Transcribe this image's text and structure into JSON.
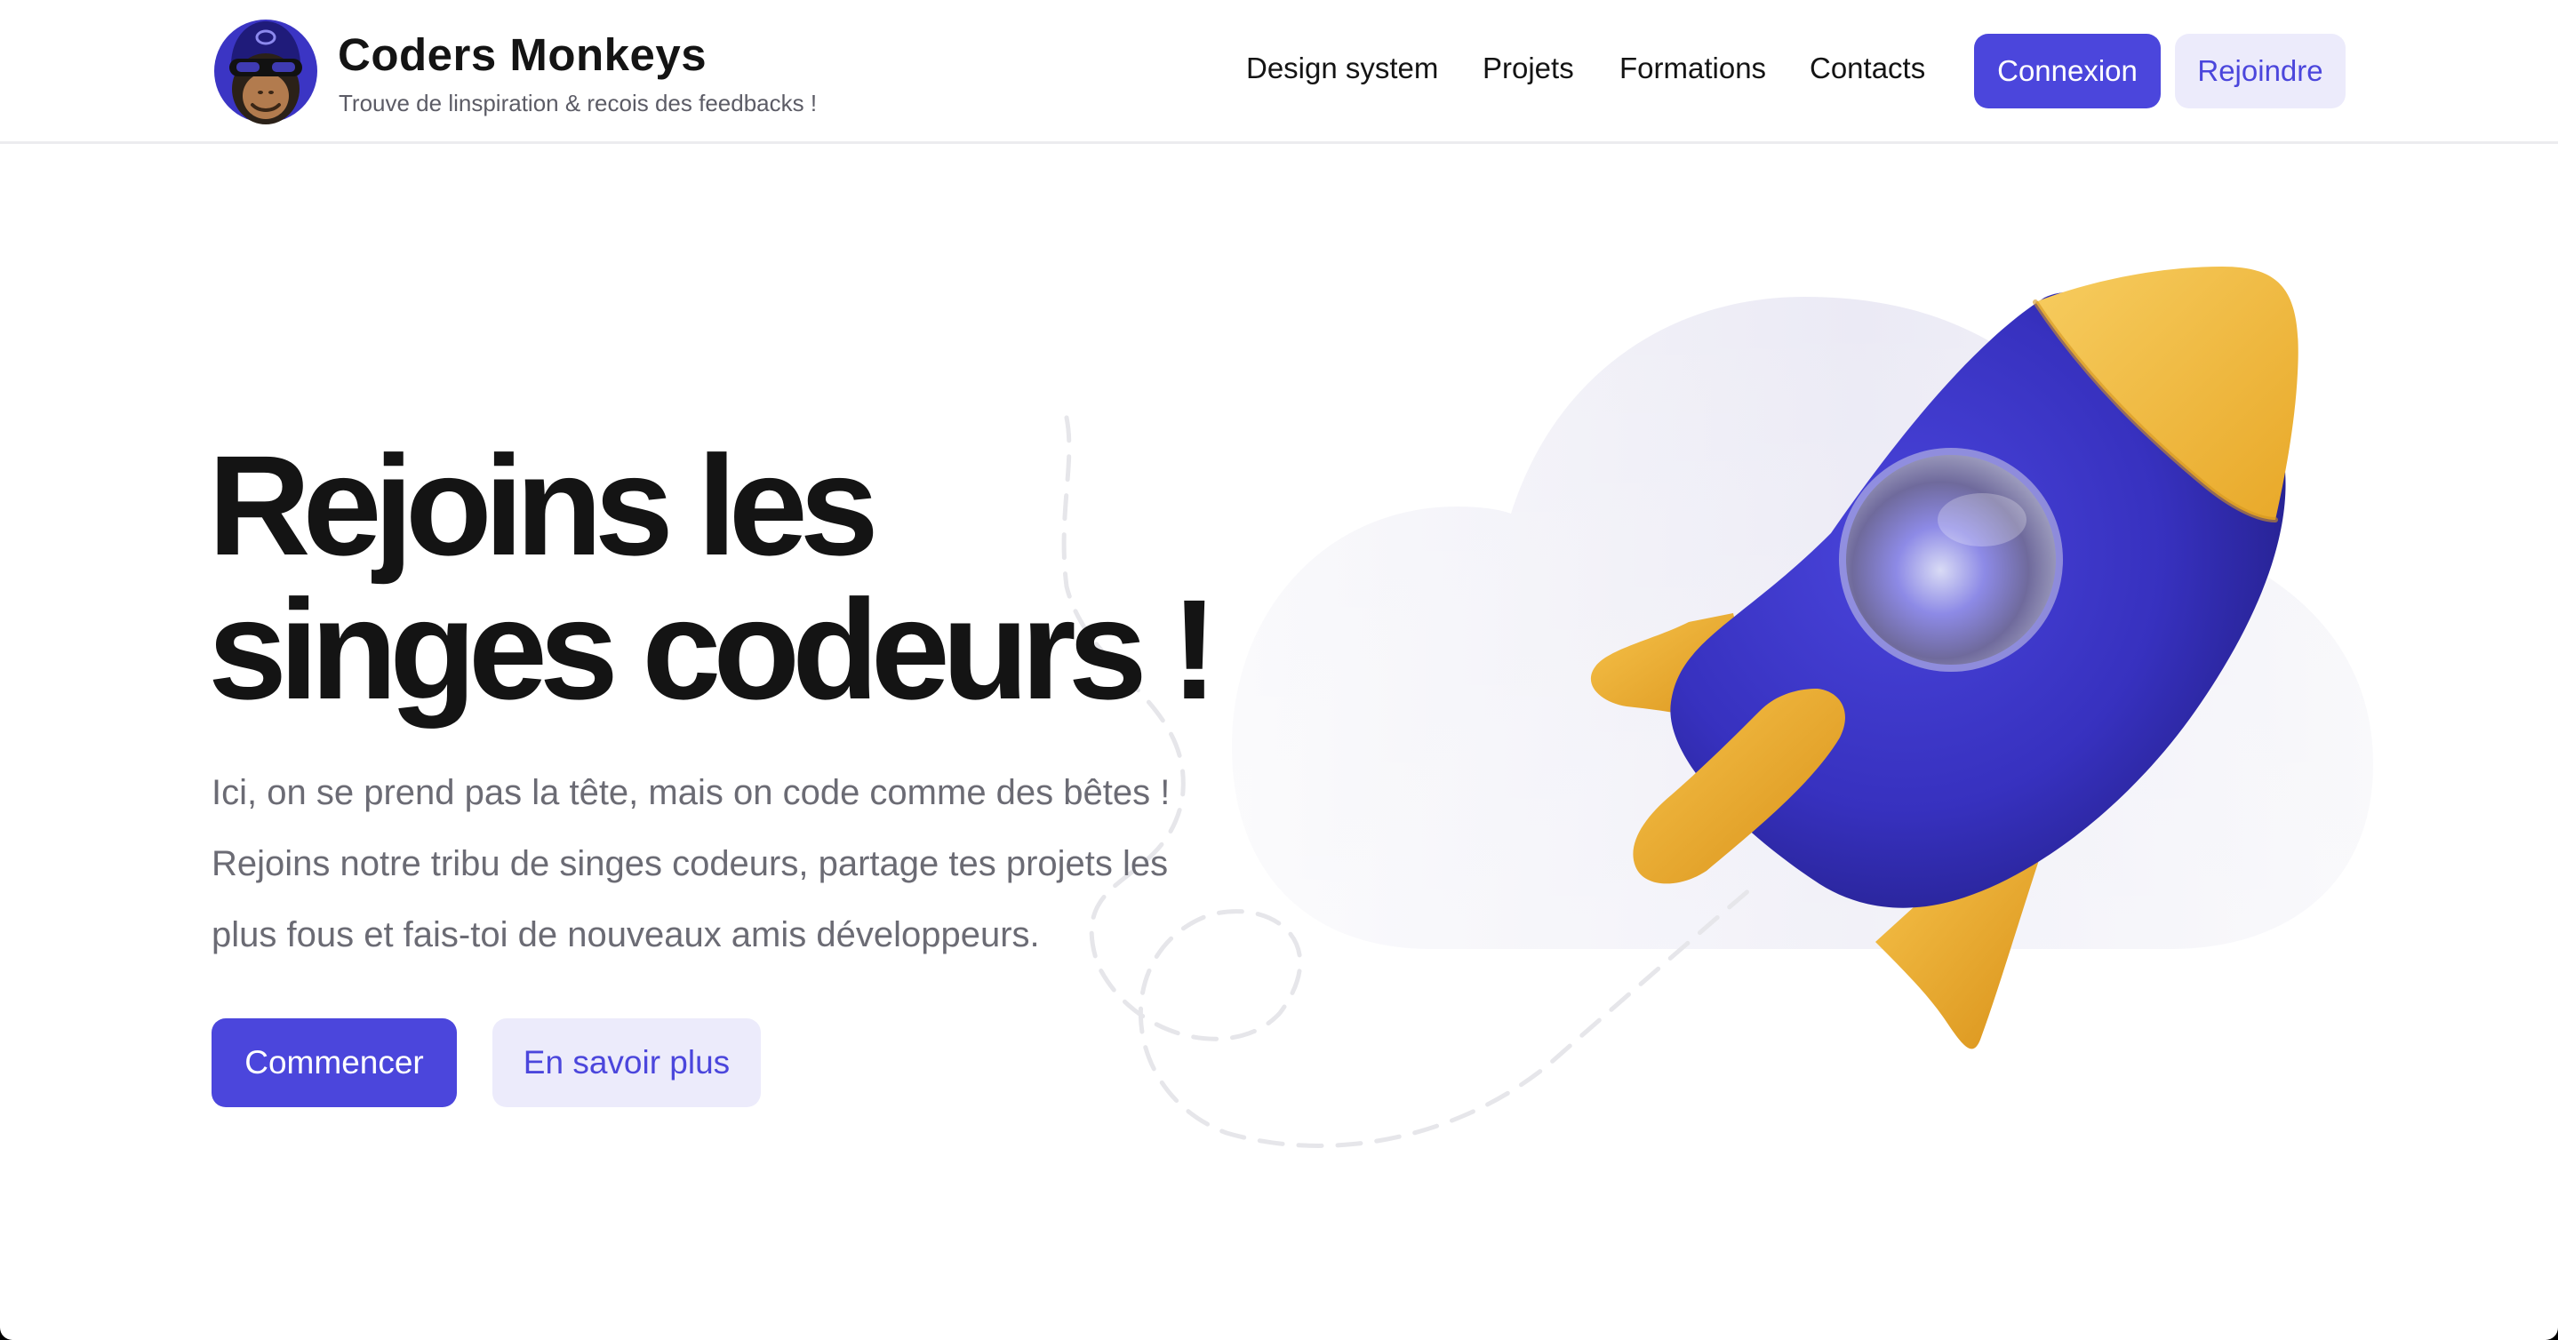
{
  "header": {
    "brand_name": "Coders Monkeys",
    "tagline": "Trouve de linspiration & recois des feedbacks !",
    "nav": [
      {
        "label": "Design system"
      },
      {
        "label": "Projets"
      },
      {
        "label": "Formations"
      },
      {
        "label": "Contacts"
      }
    ],
    "login_label": "Connexion",
    "join_label": "Rejoindre"
  },
  "hero": {
    "title_lines": [
      "Rejoins les",
      "singes codeurs !"
    ],
    "description_lines": [
      "Ici, on se prend pas la tête, mais on code comme des bêtes !",
      "Rejoins notre tribu de singes codeurs, partage tes projets les",
      "plus fous et fais-toi de nouveaux amis développeurs."
    ],
    "primary_cta": "Commencer",
    "secondary_cta": "En savoir plus"
  },
  "icons": {
    "logo": "monkey-logo-icon",
    "illustration": "rocket-icon"
  },
  "colors": {
    "accent": "#4b46dc",
    "accent_soft": "#ecebfb",
    "rocket_body": "#3b35c4",
    "rocket_fins": "#f2b32e"
  }
}
